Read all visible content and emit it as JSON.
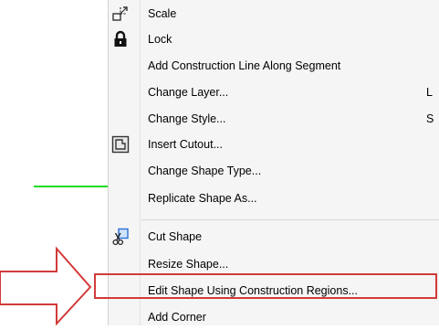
{
  "menu": {
    "items": [
      {
        "label": "Scale",
        "icon": "scale-icon"
      },
      {
        "label": "Lock",
        "icon": "lock-icon"
      },
      {
        "label": "Add Construction Line Along Segment"
      },
      {
        "label": "Change Layer...",
        "shortcut": "L"
      },
      {
        "label": "Change Style...",
        "shortcut": "S"
      },
      {
        "label": "Insert Cutout...",
        "icon": "insert-cutout-icon"
      },
      {
        "label": "Change Shape Type..."
      },
      {
        "label": "Replicate Shape As..."
      },
      {
        "label": "Cut Shape",
        "icon": "cut-shape-icon"
      },
      {
        "label": "Resize Shape..."
      },
      {
        "label": "Edit Shape Using Construction Regions..."
      },
      {
        "label": "Add Corner"
      }
    ]
  },
  "colors": {
    "highlight_border": "#d23a3a",
    "arrow_stroke": "#d23a3a",
    "guide_line": "#22dd22",
    "menu_background": "#f5f5f5"
  }
}
